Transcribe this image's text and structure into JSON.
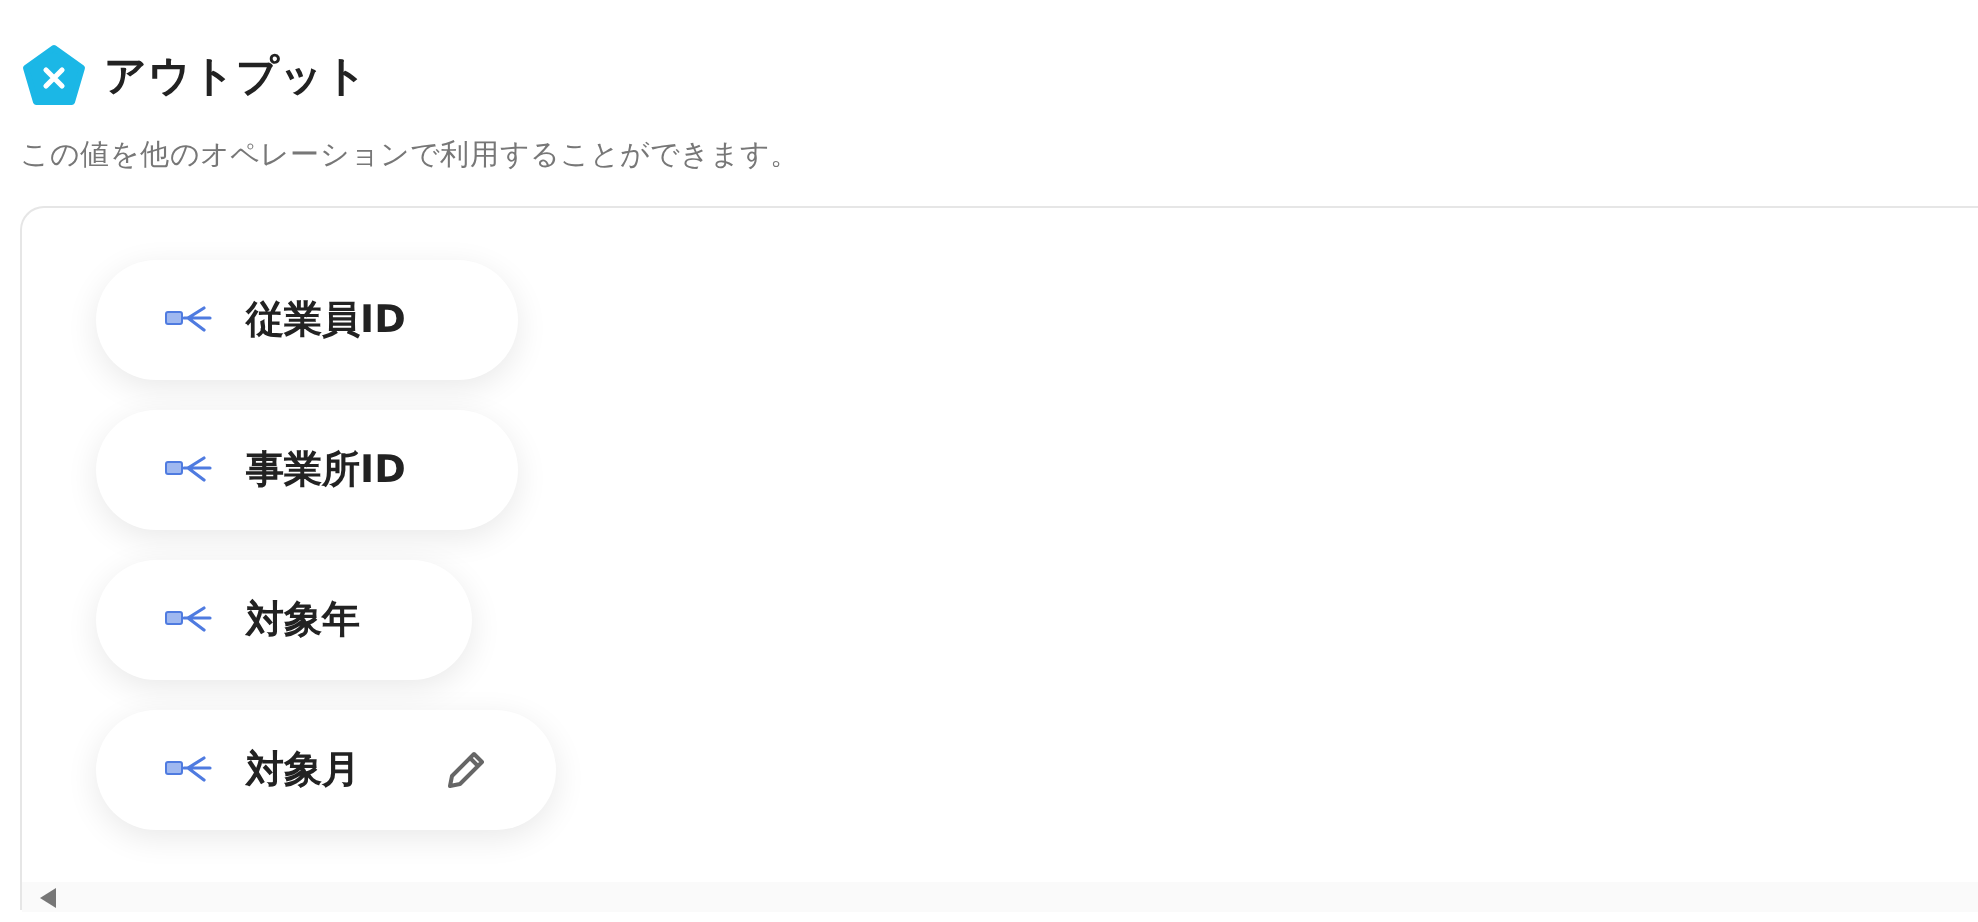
{
  "section": {
    "title": "アウトプット",
    "description": "この値を他のオペレーションで利用することができます。"
  },
  "outputs": [
    {
      "label": "従業員ID",
      "hovered": false
    },
    {
      "label": "事業所ID",
      "hovered": false
    },
    {
      "label": "対象年",
      "hovered": false
    },
    {
      "label": "対象月",
      "hovered": true
    }
  ]
}
